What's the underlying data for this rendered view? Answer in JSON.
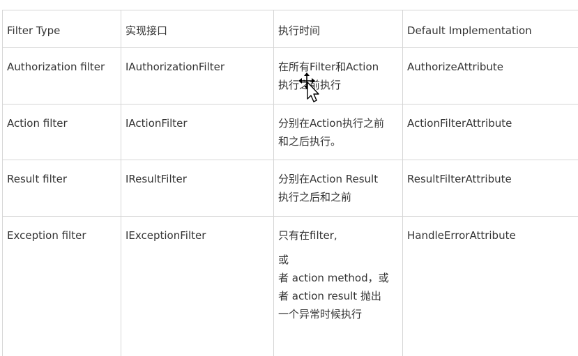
{
  "table": {
    "headers": [
      "Filter Type",
      "实现接口",
      "执行时间",
      "Default Implementation"
    ],
    "rows": [
      {
        "filter_type": "Authorization filter",
        "interface": "IAuthorizationFilter",
        "timing": [
          "在所有Filter和Action",
          "执行之前执行"
        ],
        "default_impl": "AuthorizeAttribute"
      },
      {
        "filter_type": "Action filter",
        "interface": "IActionFilter",
        "timing": [
          "分别在Action执行之前",
          "和之后执行。"
        ],
        "default_impl": "ActionFilterAttribute"
      },
      {
        "filter_type": "Result filter",
        "interface": "IResultFilter",
        "timing": [
          "分别在Action Result",
          "执行之后和之前"
        ],
        "default_impl": "ResultFilterAttribute"
      },
      {
        "filter_type": "Exception filter",
        "interface": "IExceptionFilter",
        "timing": [
          "只有在filter,",
          "或",
          "者 action method，或",
          "者 action result 抛出",
          "一个异常时候执行"
        ],
        "default_impl": "HandleErrorAttribute"
      }
    ]
  },
  "cursor": {
    "icon": "move-cursor-icon"
  }
}
